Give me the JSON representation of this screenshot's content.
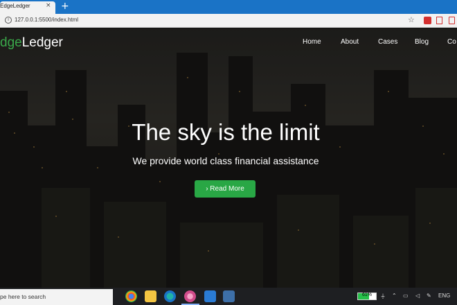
{
  "browser": {
    "tab_title": "EdgeLedger",
    "tab_close": "×",
    "new_tab": "+",
    "url": "127.0.0.1:5500/index.html",
    "info_icon": "i",
    "star_icon": "☆"
  },
  "site": {
    "brand_prefix": "dge",
    "brand_suffix": "Ledger",
    "brand_accent_color": "#3aa84a",
    "nav": [
      "Home",
      "About",
      "Cases",
      "Blog",
      "Co"
    ],
    "hero_title": "The sky is the limit",
    "hero_subtitle": "We provide world class financial assistance",
    "cta_label": "› Read More",
    "cta_color": "#29a745"
  },
  "taskbar": {
    "search_text": "pe here to search",
    "apps": [
      "chrome-icon",
      "file-explorer-icon",
      "edge-icon",
      "chrome-profile-icon",
      "vscode-icon",
      "app-icon"
    ],
    "battery_percent": 61,
    "battery_label": "61%",
    "language": "ENG"
  }
}
